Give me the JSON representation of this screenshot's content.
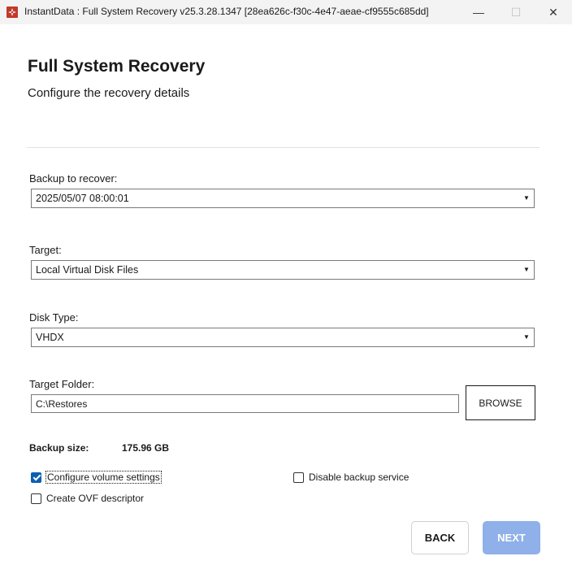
{
  "window": {
    "title": "InstantData : Full System Recovery v25.3.28.1347 [28ea626c-f30c-4e47-aeae-cf9555c685dd]",
    "minimize_glyph": "—",
    "maximize_glyph": "☐",
    "close_glyph": "✕",
    "icon": "app-logo-icon",
    "icon_color": "#c0392b"
  },
  "header": {
    "title": "Full System Recovery",
    "subtitle": "Configure the recovery details"
  },
  "form": {
    "backup": {
      "label": "Backup to recover:",
      "value": "2025/05/07 08:00:01"
    },
    "target": {
      "label": "Target:",
      "value": "Local Virtual Disk Files"
    },
    "disk_type": {
      "label": "Disk Type:",
      "value": "VHDX"
    },
    "target_folder": {
      "label": "Target Folder:",
      "value": "C:\\Restores",
      "browse_label": "BROWSE"
    },
    "caret_glyph": "▼"
  },
  "summary": {
    "backup_size_label": "Backup size:",
    "backup_size_value": "175.96 GB"
  },
  "options": {
    "configure_volume": {
      "label": "Configure volume settings",
      "checked": true
    },
    "disable_backup_service": {
      "label": "Disable backup service",
      "checked": false
    },
    "create_ovf": {
      "label": "Create OVF descriptor",
      "checked": false
    }
  },
  "footer": {
    "back_label": "BACK",
    "next_label": "NEXT"
  },
  "colors": {
    "accent": "#0a5fb4",
    "next_disabled": "#8fb0e8",
    "titlebar": "#f3f3f3"
  }
}
